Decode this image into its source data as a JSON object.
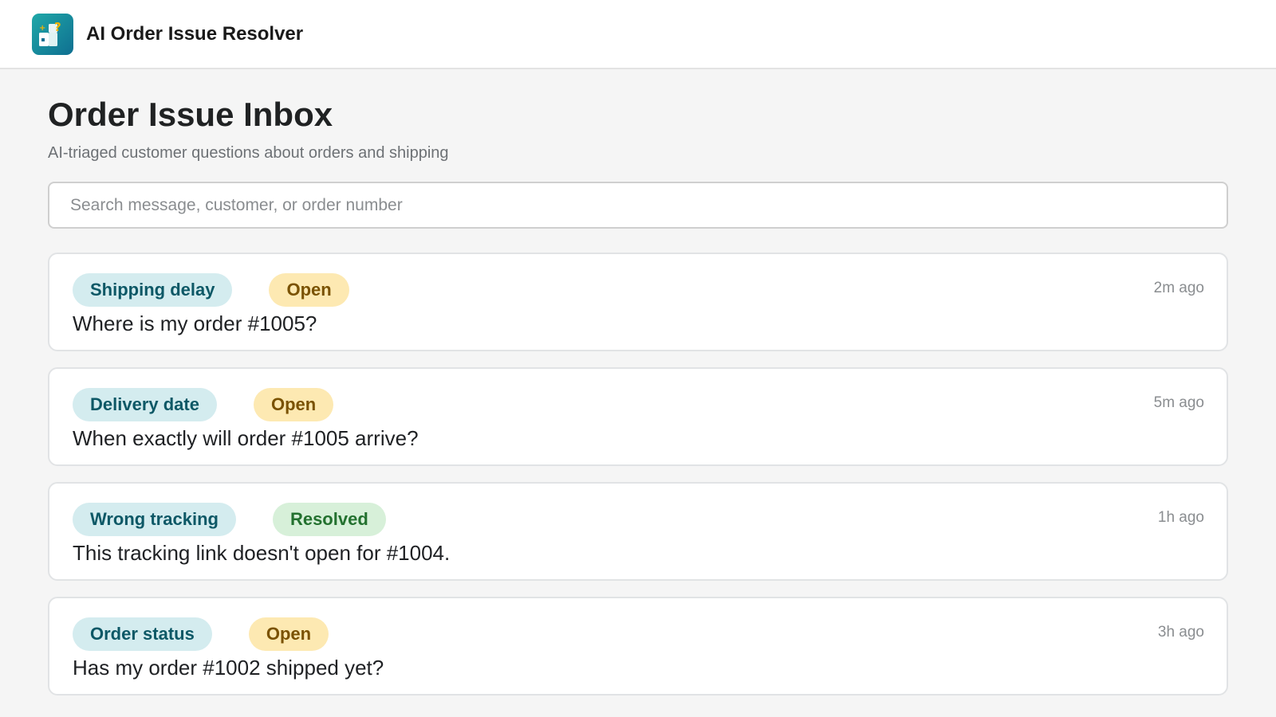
{
  "app": {
    "title": "AI Order Issue Resolver",
    "logo_icon": "question-box-logo-icon",
    "accent": "#1fa8a8"
  },
  "page": {
    "title": "Order Issue Inbox",
    "subtitle": "AI-triaged customer questions about orders and shipping"
  },
  "search": {
    "placeholder": "Search message, customer, or order number",
    "value": ""
  },
  "issues": [
    {
      "category": "Shipping delay",
      "status": "Open",
      "message": "Where is my order #1005?",
      "time": "2m ago"
    },
    {
      "category": "Delivery date",
      "status": "Open",
      "message": "When exactly will order #1005 arrive?",
      "time": "5m ago"
    },
    {
      "category": "Wrong tracking",
      "status": "Resolved",
      "message": "This tracking link doesn't open for #1004.",
      "time": "1h ago"
    },
    {
      "category": "Order status",
      "status": "Open",
      "message": "Has my order #1002 shipped yet?",
      "time": "3h ago"
    }
  ],
  "status_colors": {
    "Open": "#fde9b2",
    "Resolved": "#d7f0d9"
  }
}
